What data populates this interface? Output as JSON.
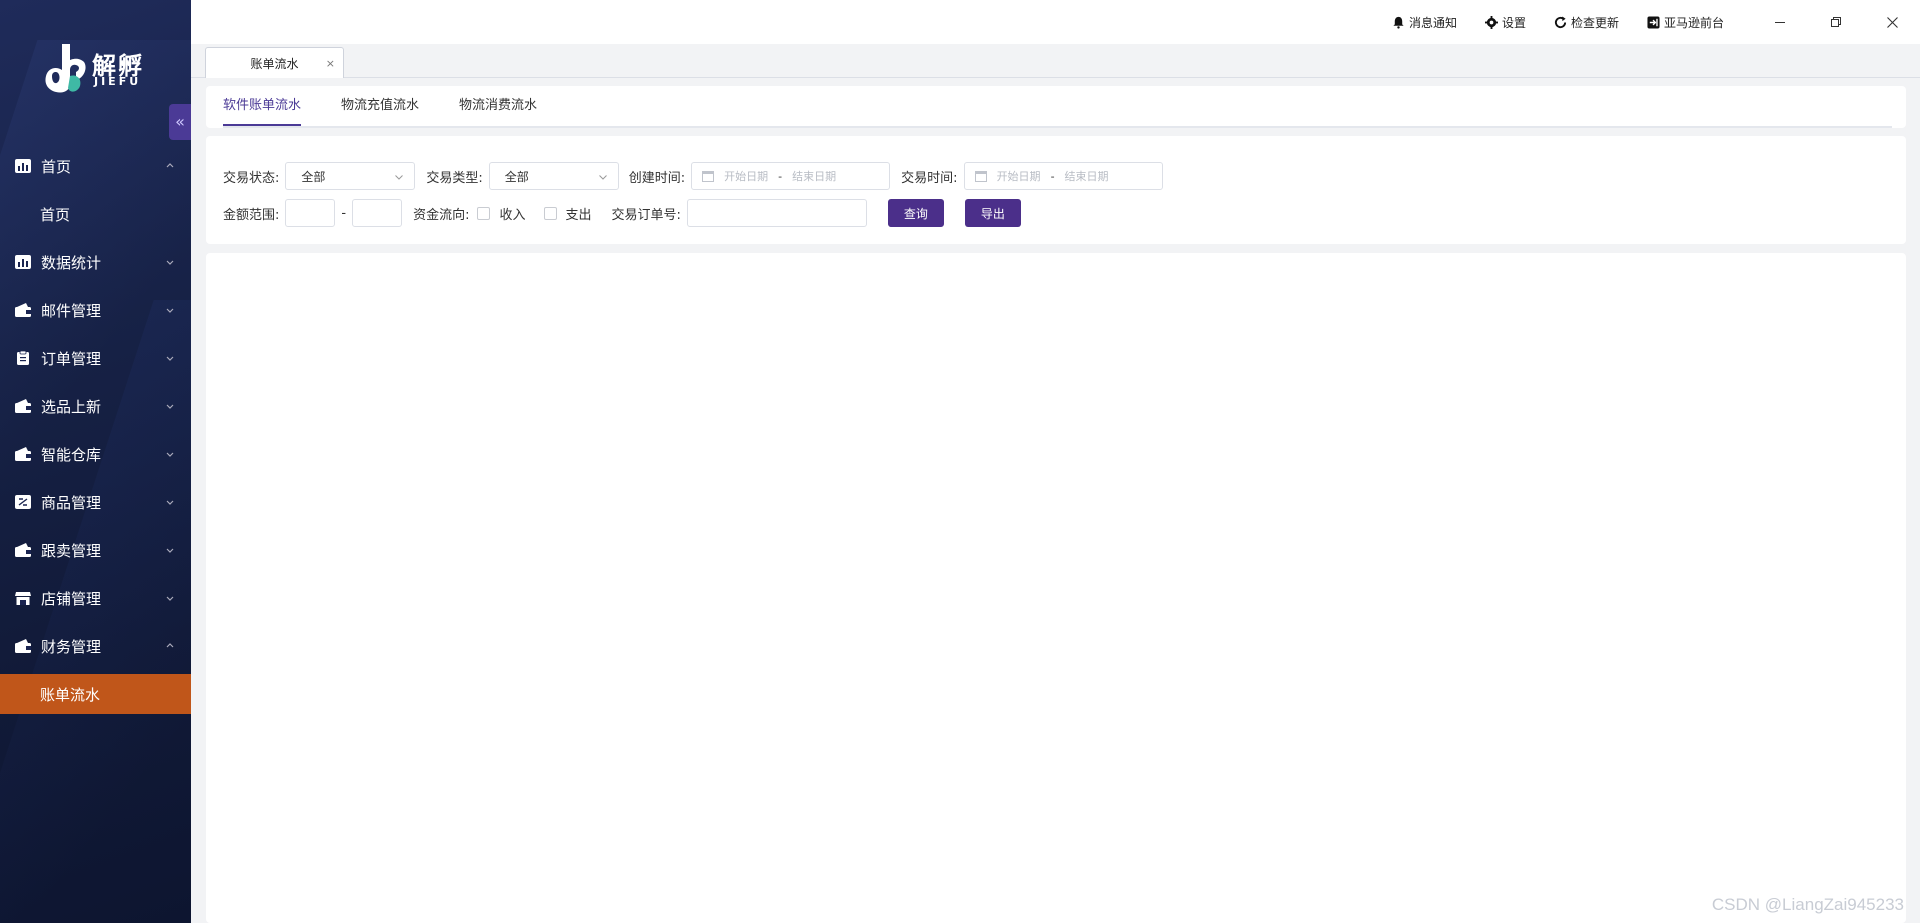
{
  "app": {
    "logo_cn": "解孵",
    "logo_en": "JIEFU"
  },
  "sidebar": {
    "items": [
      {
        "label": "首页",
        "icon": "chart-icon",
        "expanded": true,
        "children": [
          {
            "label": "首页",
            "active": false
          }
        ]
      },
      {
        "label": "数据统计",
        "icon": "chart-icon",
        "expanded": false
      },
      {
        "label": "邮件管理",
        "icon": "wallet-icon",
        "expanded": false
      },
      {
        "label": "订单管理",
        "icon": "clipboard-icon",
        "expanded": false
      },
      {
        "label": "选品上新",
        "icon": "wallet-icon",
        "expanded": false
      },
      {
        "label": "智能仓库",
        "icon": "wallet-icon",
        "expanded": false
      },
      {
        "label": "商品管理",
        "icon": "goods-icon",
        "expanded": false
      },
      {
        "label": "跟卖管理",
        "icon": "wallet-icon",
        "expanded": false
      },
      {
        "label": "店铺管理",
        "icon": "store-icon",
        "expanded": false
      },
      {
        "label": "财务管理",
        "icon": "wallet-icon",
        "expanded": true,
        "children": [
          {
            "label": "账单流水",
            "active": true
          }
        ]
      }
    ],
    "active_color": "#c0561a"
  },
  "topbar": {
    "notify_label": "消息通知",
    "settings_label": "设置",
    "update_label": "检查更新",
    "amazon_label": "亚马逊前台"
  },
  "page_tabs": [
    {
      "label": "账单流水",
      "close": "×"
    }
  ],
  "subtabs": [
    {
      "label": "软件账单流水",
      "active": true
    },
    {
      "label": "物流充值流水",
      "active": false
    },
    {
      "label": "物流消费流水",
      "active": false
    }
  ],
  "filters": {
    "status_label": "交易状态:",
    "status_value": "全部",
    "type_label": "交易类型:",
    "type_value": "全部",
    "created_label": "创建时间:",
    "trade_time_label": "交易时间:",
    "start_date_placeholder": "开始日期",
    "end_date_placeholder": "结束日期",
    "date_sep": "-",
    "amount_label": "金额范围:",
    "amount_sep": "-",
    "flow_label": "资金流向:",
    "income_label": "收入",
    "expense_label": "支出",
    "order_no_label": "交易订单号:",
    "query_btn": "查询",
    "export_btn": "导出"
  },
  "accent_color": "#4b2f8a",
  "watermark": "CSDN @LiangZai945233"
}
